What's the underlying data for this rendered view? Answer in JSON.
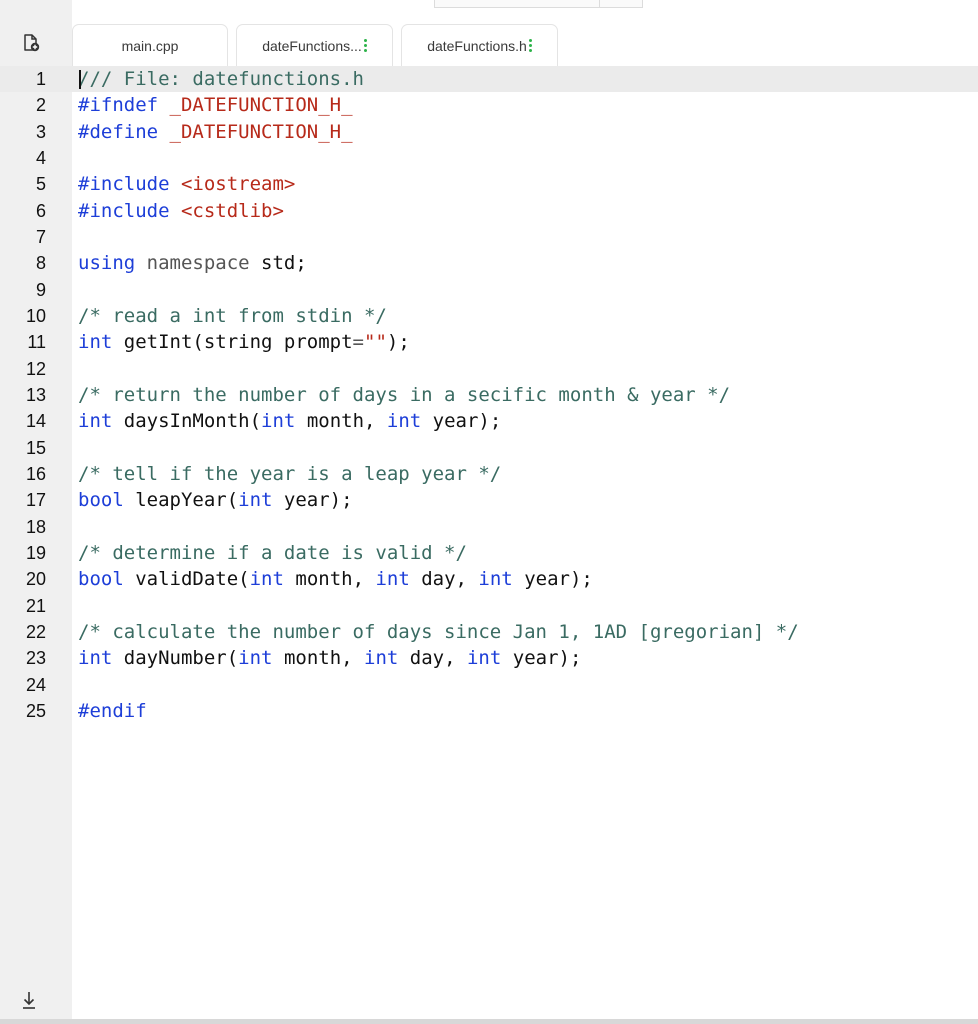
{
  "tabs": [
    {
      "label": "main.cpp",
      "menu": false
    },
    {
      "label": "dateFunctions...",
      "menu": true
    },
    {
      "label": "dateFunctions.h",
      "menu": true
    }
  ],
  "gutter": {
    "new_file_icon": "new-file-icon",
    "download_icon": "download-icon"
  },
  "colors": {
    "keyword": "#1d3ed8",
    "comment": "#3a6b62",
    "macro": "#b72a1a",
    "menu_dots": "#2db34a"
  },
  "editor": {
    "lines": [
      {
        "n": "1",
        "tokens": [
          [
            "cm",
            "/// File: datefunctions.h"
          ]
        ]
      },
      {
        "n": "2",
        "tokens": [
          [
            "pp",
            "#ifndef"
          ],
          [
            "",
            " "
          ],
          [
            "mac",
            "_DATEFUNCTION_H_"
          ]
        ]
      },
      {
        "n": "3",
        "tokens": [
          [
            "pp",
            "#define"
          ],
          [
            "",
            " "
          ],
          [
            "mac",
            "_DATEFUNCTION_H_"
          ]
        ]
      },
      {
        "n": "4",
        "tokens": []
      },
      {
        "n": "5",
        "tokens": [
          [
            "pp",
            "#include"
          ],
          [
            "",
            " "
          ],
          [
            "inc",
            "<iostream>"
          ]
        ]
      },
      {
        "n": "6",
        "tokens": [
          [
            "pp",
            "#include"
          ],
          [
            "",
            " "
          ],
          [
            "inc",
            "<cstdlib>"
          ]
        ]
      },
      {
        "n": "7",
        "tokens": []
      },
      {
        "n": "8",
        "tokens": [
          [
            "kw",
            "using"
          ],
          [
            "",
            " "
          ],
          [
            "ns",
            "namespace"
          ],
          [
            "",
            " std;"
          ]
        ]
      },
      {
        "n": "9",
        "tokens": []
      },
      {
        "n": "10",
        "tokens": [
          [
            "cm",
            "/* read a int from stdin */"
          ]
        ]
      },
      {
        "n": "11",
        "tokens": [
          [
            "kw",
            "int"
          ],
          [
            "",
            " getInt(string prompt"
          ],
          [
            "op",
            "="
          ],
          [
            "str",
            "\"\""
          ],
          [
            "",
            ");"
          ]
        ]
      },
      {
        "n": "12",
        "tokens": []
      },
      {
        "n": "13",
        "tokens": [
          [
            "cm",
            "/* return the number of days in a secific month & year */"
          ]
        ]
      },
      {
        "n": "14",
        "tokens": [
          [
            "kw",
            "int"
          ],
          [
            "",
            " daysInMonth("
          ],
          [
            "kw",
            "int"
          ],
          [
            "",
            " month, "
          ],
          [
            "kw",
            "int"
          ],
          [
            "",
            " year);"
          ]
        ]
      },
      {
        "n": "15",
        "tokens": []
      },
      {
        "n": "16",
        "tokens": [
          [
            "cm",
            "/* tell if the year is a leap year */"
          ]
        ]
      },
      {
        "n": "17",
        "tokens": [
          [
            "kw",
            "bool"
          ],
          [
            "",
            " leapYear("
          ],
          [
            "kw",
            "int"
          ],
          [
            "",
            " year);"
          ]
        ]
      },
      {
        "n": "18",
        "tokens": []
      },
      {
        "n": "19",
        "tokens": [
          [
            "cm",
            "/* determine if a date is valid */"
          ]
        ]
      },
      {
        "n": "20",
        "tokens": [
          [
            "kw",
            "bool"
          ],
          [
            "",
            " validDate("
          ],
          [
            "kw",
            "int"
          ],
          [
            "",
            " month, "
          ],
          [
            "kw",
            "int"
          ],
          [
            "",
            " day, "
          ],
          [
            "kw",
            "int"
          ],
          [
            "",
            " year);"
          ]
        ]
      },
      {
        "n": "21",
        "tokens": []
      },
      {
        "n": "22",
        "tokens": [
          [
            "cm",
            "/* calculate the number of days since Jan 1, 1AD [gregorian] */"
          ]
        ]
      },
      {
        "n": "23",
        "tokens": [
          [
            "kw",
            "int"
          ],
          [
            "",
            " dayNumber("
          ],
          [
            "kw",
            "int"
          ],
          [
            "",
            " month, "
          ],
          [
            "kw",
            "int"
          ],
          [
            "",
            " day, "
          ],
          [
            "kw",
            "int"
          ],
          [
            "",
            " year);"
          ]
        ]
      },
      {
        "n": "24",
        "tokens": []
      },
      {
        "n": "25",
        "tokens": [
          [
            "pp",
            "#endif"
          ]
        ]
      }
    ]
  }
}
